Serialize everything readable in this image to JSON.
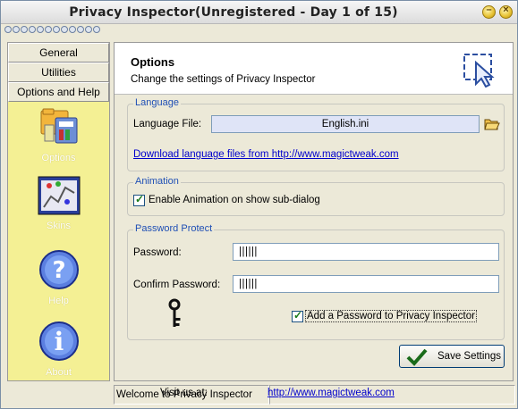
{
  "window": {
    "title": "Privacy Inspector(Unregistered - Day 1 of 15)",
    "minimize_glyph": "–",
    "close_glyph": "×"
  },
  "sidebar": {
    "tabs": [
      {
        "label": "General"
      },
      {
        "label": "Utilities"
      },
      {
        "label": "Options and Help"
      }
    ],
    "items": [
      {
        "label": "Options",
        "icon": "options-icon"
      },
      {
        "label": "Skins",
        "icon": "skins-icon"
      },
      {
        "label": "Help",
        "icon": "help-icon"
      },
      {
        "label": "About",
        "icon": "about-icon"
      }
    ]
  },
  "header": {
    "title": "Options",
    "subtitle": "Change the settings of Privacy Inspector",
    "icon": "cursor-icon"
  },
  "language": {
    "group_title": "Language",
    "file_label": "Language File:",
    "file_value": "English.ini",
    "browse_icon": "folder-open-icon",
    "download_link": "Download language files from http://www.magictweak.com"
  },
  "animation": {
    "group_title": "Animation",
    "enable_label": "Enable Animation on show sub-dialog",
    "enabled": true
  },
  "password": {
    "group_title": "Password Protect",
    "password_label": "Password:",
    "password_value": "||||||",
    "confirm_label": "Confirm Password:",
    "confirm_value": "||||||",
    "key_icon": "key-icon",
    "add_label": "Add a Password to Privacy Inspector",
    "add_checked": true
  },
  "actions": {
    "save_label": "Save Settings"
  },
  "status": {
    "welcome": "Welcome to Privacy Inspector",
    "visit_label": "Visit us at:",
    "visit_link": "http://www.magictweak.com"
  },
  "colors": {
    "sidebar_bg": "#f4f094",
    "group_title": "#1f4fb5",
    "link": "#0000cc"
  }
}
